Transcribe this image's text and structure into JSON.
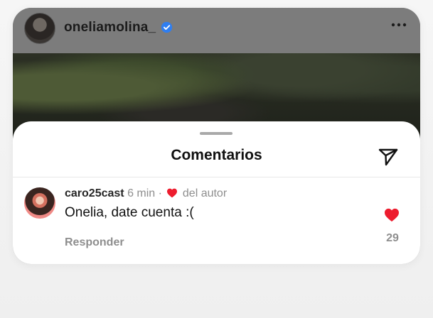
{
  "post": {
    "username": "oneliamolina_",
    "verified_icon": "verified-badge-icon",
    "more_icon": "more-options-icon"
  },
  "comments_sheet": {
    "title": "Comentarios",
    "send_icon": "paper-plane-icon"
  },
  "comment": {
    "username": "caro25cast",
    "time": "6 min",
    "separator": "·",
    "author_liked": "del autor",
    "text": "Onelia, date cuenta :(",
    "reply_label": "Responder",
    "like_count": "29",
    "liked": true
  },
  "colors": {
    "heart": "#ed1c2e",
    "verified": "#2f7ef0",
    "muted_text": "#8e8e8e"
  }
}
